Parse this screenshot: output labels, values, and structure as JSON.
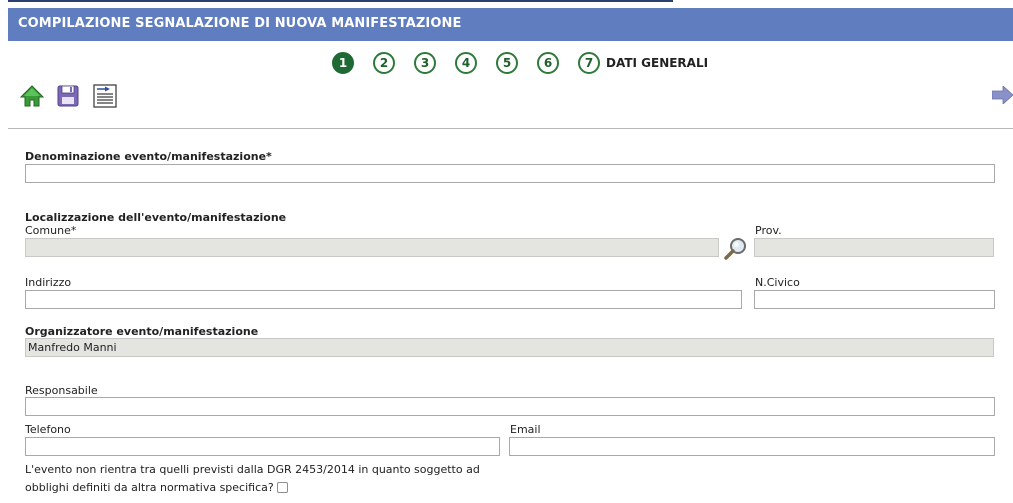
{
  "header": {
    "title": "COMPILAZIONE SEGNALAZIONE DI NUOVA MANIFESTAZIONE"
  },
  "wizard": {
    "steps": [
      "1",
      "2",
      "3",
      "4",
      "5",
      "6",
      "7"
    ],
    "active_step": "1",
    "current_label": "DATI GENERALI"
  },
  "toolbar": {
    "icons": [
      "home-icon",
      "save-icon",
      "import-icon",
      "next-arrow-icon"
    ],
    "colors": {
      "home": "#2e8b2e",
      "save": "#6f5aa8",
      "next": "#7a7fc0"
    }
  },
  "form": {
    "denominazione": {
      "label": "Denominazione evento/manifestazione*",
      "value": ""
    },
    "localizzazione": {
      "section_label": "Localizzazione dell'evento/manifestazione",
      "comune_label": "Comune*",
      "comune_value": "",
      "prov_label": "Prov.",
      "prov_value": "",
      "indirizzo_label": "Indirizzo",
      "indirizzo_value": "",
      "civico_label": "N.Civico",
      "civico_value": ""
    },
    "organizzatore": {
      "label": "Organizzatore evento/manifestazione",
      "value": "Manfredo Manni"
    },
    "responsabile": {
      "label": "Responsabile",
      "value": ""
    },
    "telefono": {
      "label": "Telefono",
      "value": ""
    },
    "email": {
      "label": "Email",
      "value": ""
    },
    "dgr_question": {
      "line1": "L'evento non rientra tra quelli previsti dalla DGR 2453/2014 in quanto soggetto ad",
      "line2": "obblighi definiti da altra normativa specifica?",
      "checked": false
    }
  },
  "colors": {
    "header_bg": "#5f7dbf",
    "step_active": "#1f6a34",
    "step_border": "#2f7a3b",
    "readonly_bg": "#e4e4e0"
  }
}
